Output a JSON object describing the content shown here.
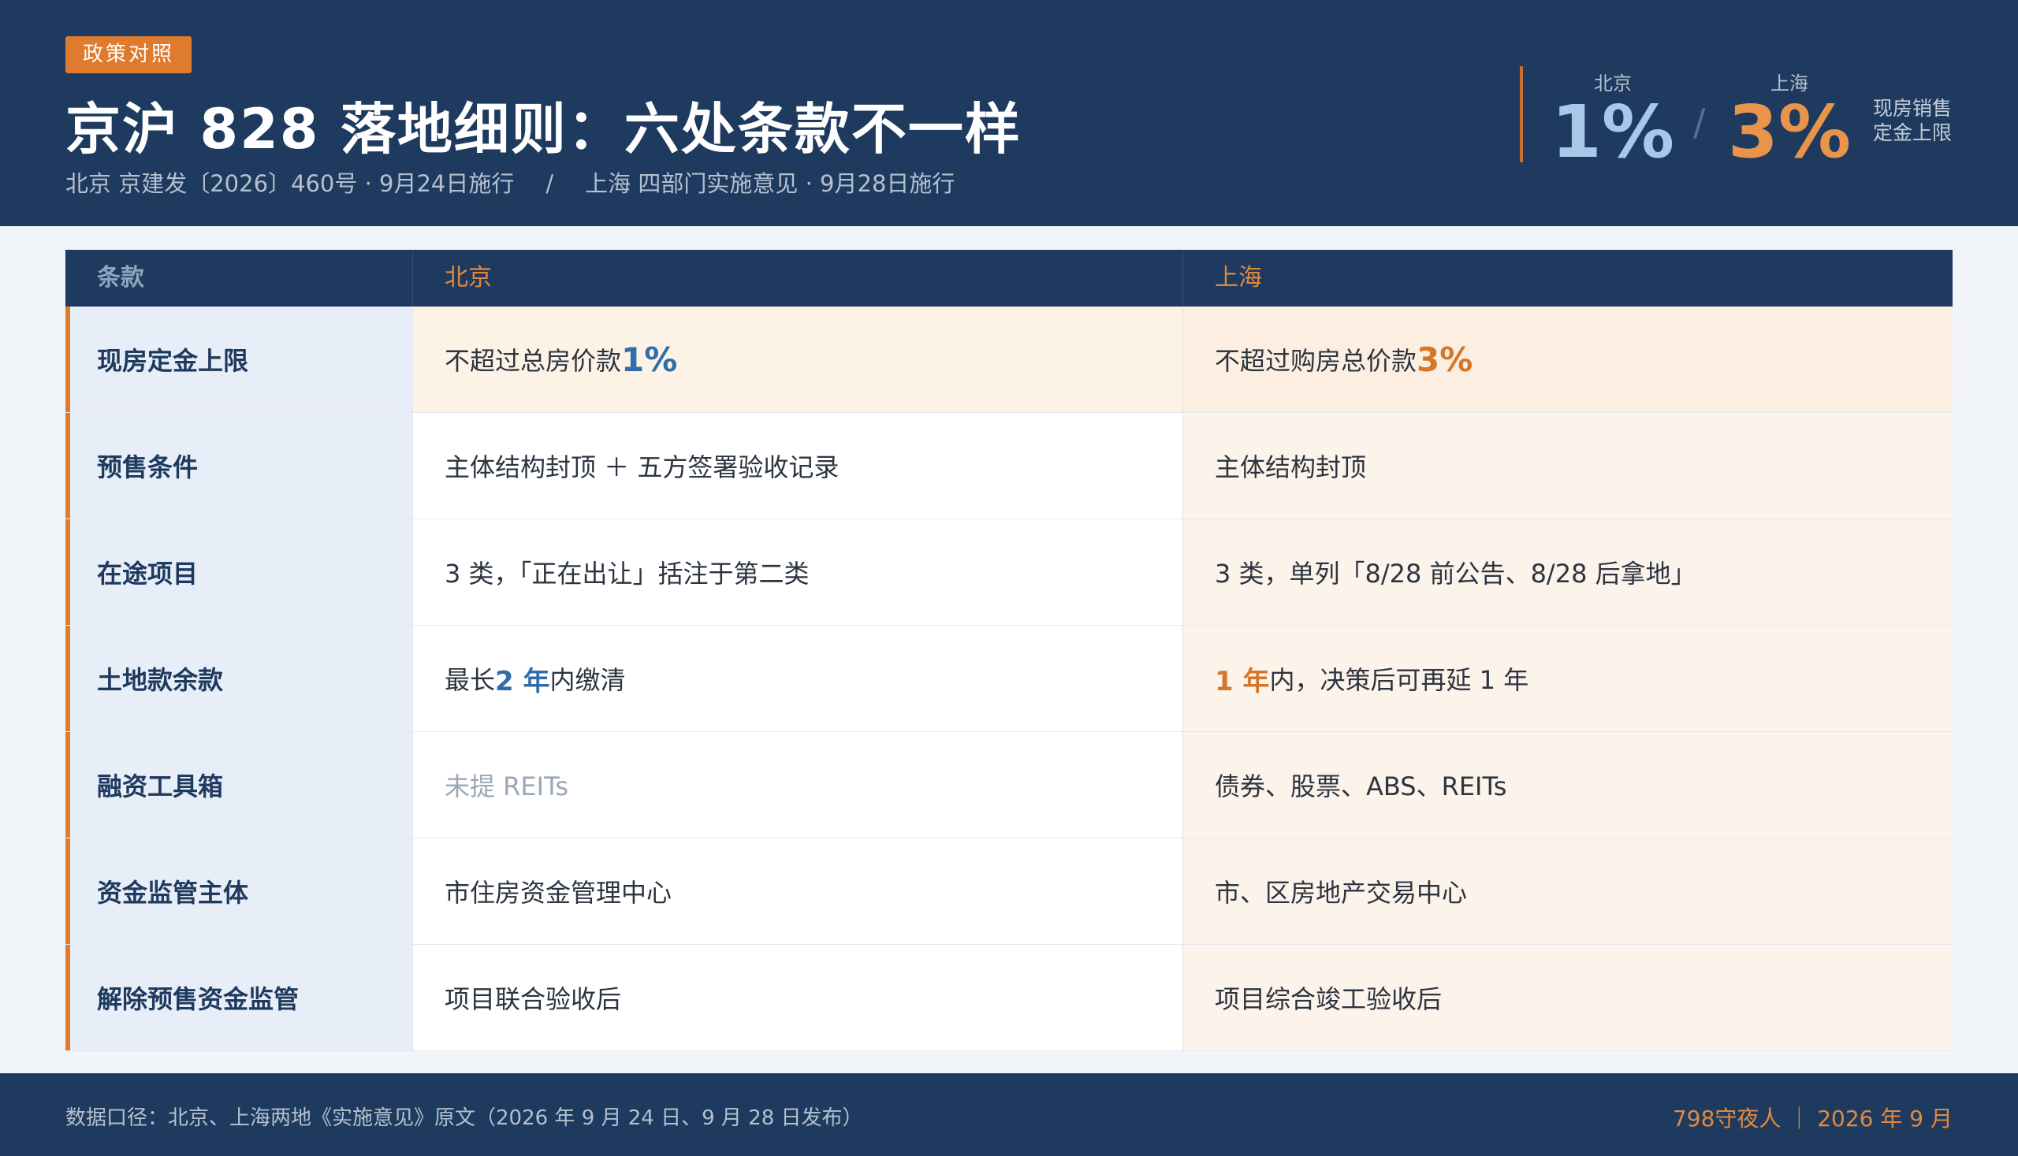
{
  "header": {
    "tag": "政策对照",
    "title": "京沪 828 落地细则：六处条款不一样",
    "subtitle_bj": "北京 京建发〔2026〕460号 · 9月24日施行",
    "subtitle_sep": "/",
    "subtitle_sh": "上海 四部门实施意见 · 9月28日施行"
  },
  "stats": {
    "bj_label": "北京",
    "bj_value": "1%",
    "slash": "/",
    "sh_label": "上海",
    "sh_value": "3%",
    "note_line1": "现房销售",
    "note_line2": "定金上限"
  },
  "table": {
    "headers": [
      "条款",
      "北京",
      "上海"
    ],
    "rows": [
      {
        "term": "现房定金上限",
        "bj_text": "不超过总房价款",
        "bj_strong": "1%",
        "sh_text": "不超过购房总价款",
        "sh_strong": "3%"
      },
      {
        "term": "预售条件",
        "bj": "主体结构封顶 ＋ 五方签署验收记录",
        "sh": "主体结构封顶"
      },
      {
        "term": "在途项目",
        "bj": "3 类，「正在出让」括注于第二类",
        "sh": "3 类，单列「8/28 前公告、8/28 后拿地」"
      },
      {
        "term": "土地款余款",
        "bj_pre": "最长",
        "bj_strong": "2 年",
        "bj_post": "内缴清",
        "sh_strong": "1 年",
        "sh_post": "内，决策后可再延 1 年"
      },
      {
        "term": "融资工具箱",
        "bj": "未提 REITs",
        "sh": "债券、股票、ABS、REITs"
      },
      {
        "term": "资金监管主体",
        "bj": "市住房资金管理中心",
        "sh": "市、区房地产交易中心"
      },
      {
        "term": "解除预售资金监管",
        "bj": "项目联合验收后",
        "sh": "项目综合竣工验收后"
      }
    ]
  },
  "footer": {
    "source": "数据口径：北京、上海两地《实施意见》原文（2026 年 9 月 24 日、9 月 28 日发布）",
    "credit": "798守夜人 ｜ 2026 年 9 月"
  },
  "colors": {
    "navy": "#1e3a5f",
    "orange": "#de7b2e",
    "beijing_blue": "#2f6eaa",
    "shanghai_orange": "#d5772a"
  }
}
